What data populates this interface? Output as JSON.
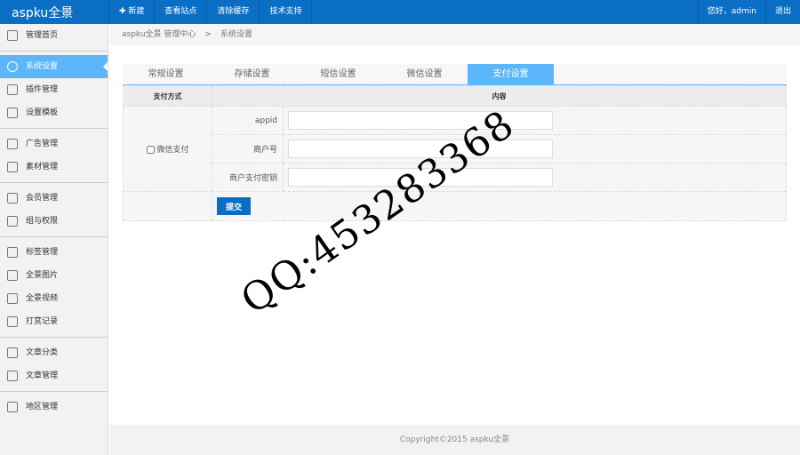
{
  "app": {
    "logo": "aspku全景"
  },
  "topnav": [
    {
      "label": "✚ 新建"
    },
    {
      "label": "查看站点"
    },
    {
      "label": "清除缓存"
    },
    {
      "label": "技术支持"
    }
  ],
  "user": {
    "greeting": "您好，admin",
    "logout": "退出"
  },
  "sidebar": {
    "items": [
      "管理首页",
      "系统设置",
      "插件管理",
      "设置模板",
      "广告管理",
      "素材管理",
      "会员管理",
      "组与权限",
      "标签管理",
      "全景图片",
      "全景视频",
      "打赏记录",
      "文章分类",
      "文章管理",
      "地区管理"
    ]
  },
  "breadcrumb": {
    "root": "aspku全景 管理中心",
    "sep": ">",
    "current": "系统设置"
  },
  "tabs": [
    "常规设置",
    "存储设置",
    "短信设置",
    "微信设置",
    "支付设置"
  ],
  "table": {
    "col1": "支付方式",
    "col2": "内容",
    "method": "微信支付",
    "fields": [
      {
        "label": "appid",
        "value": ""
      },
      {
        "label": "商户号",
        "value": ""
      },
      {
        "label": "商户支付密钥",
        "value": ""
      }
    ],
    "submit": "提交"
  },
  "footer": "Copyright©2015    aspku全景",
  "watermark": "QQ:453283368"
}
